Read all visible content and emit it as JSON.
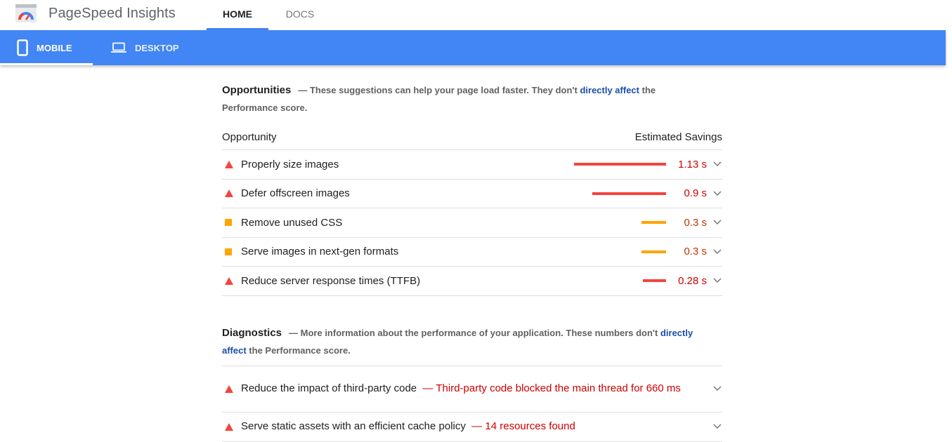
{
  "header": {
    "brand": "PageSpeed Insights",
    "tabs": [
      {
        "label": "HOME",
        "active": true
      },
      {
        "label": "DOCS",
        "active": false
      }
    ]
  },
  "device_tabs": [
    {
      "label": "MOBILE",
      "icon": "phone-icon",
      "active": true
    },
    {
      "label": "DESKTOP",
      "icon": "laptop-icon",
      "active": false
    }
  ],
  "opportunities": {
    "title": "Opportunities",
    "desc_prefix": "— These suggestions can help your page load faster. They don't ",
    "desc_link": "directly affect",
    "desc_mid": " the",
    "desc_suffix": "Performance score.",
    "col_left": "Opportunity",
    "col_right": "Estimated Savings",
    "items": [
      {
        "title": "Properly size images",
        "value": "1.13 s",
        "severity": "fail",
        "savings_fraction": 1.0
      },
      {
        "title": "Defer offscreen images",
        "value": "0.9 s",
        "severity": "fail",
        "savings_fraction": 0.8
      },
      {
        "title": "Remove unused CSS",
        "value": "0.3 s",
        "severity": "average",
        "savings_fraction": 0.27
      },
      {
        "title": "Serve images in next-gen formats",
        "value": "0.3 s",
        "severity": "average",
        "savings_fraction": 0.27
      },
      {
        "title": "Reduce server response times (TTFB)",
        "value": "0.28 s",
        "severity": "fail",
        "savings_fraction": 0.25
      }
    ]
  },
  "diagnostics": {
    "title": "Diagnostics",
    "desc_prefix": "— More information about the performance of your application. These numbers don't ",
    "desc_link_1": "directly",
    "desc_link_2": "affect",
    "desc_suffix": " the Performance score.",
    "items": [
      {
        "title": "Reduce the impact of third-party code",
        "detail": "— Third-party code blocked the main thread for 660 ms",
        "severity": "fail"
      },
      {
        "title": "Serve static assets with an efficient cache policy",
        "detail": "— 14 resources found",
        "severity": "fail"
      }
    ]
  },
  "colors": {
    "accent": "#4285f4",
    "fail": "#f4443f",
    "average": "#ffa400",
    "fail_text": "#cc0000",
    "average_text": "#c33300",
    "link": "#1a4ea8"
  }
}
